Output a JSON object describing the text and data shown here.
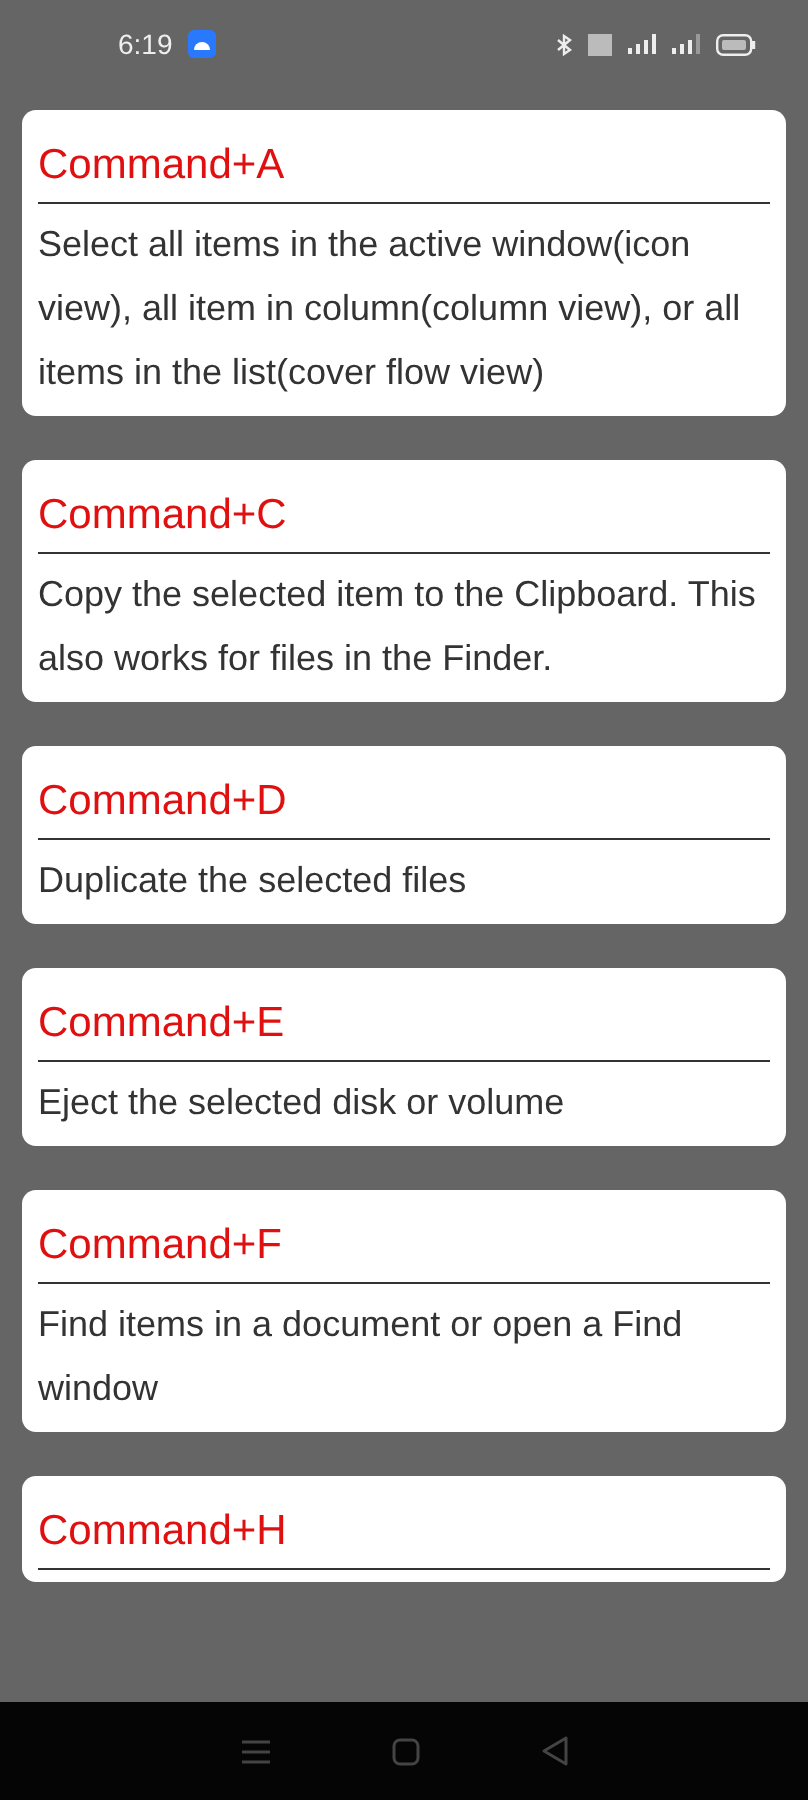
{
  "status_bar": {
    "time": "6:19"
  },
  "shortcuts": [
    {
      "keys": "Command+A",
      "description": "Select all items in the active window(icon view), all item in column(column view), or all items in the list(cover flow view)"
    },
    {
      "keys": "Command+C",
      "description": "Copy the selected item to the Clipboard. This also works for files in the Finder."
    },
    {
      "keys": "Command+D",
      "description": "Duplicate the selected files"
    },
    {
      "keys": "Command+E",
      "description": "Eject the selected disk or volume"
    },
    {
      "keys": "Command+F",
      "description": "Find items in a document or open a Find window"
    },
    {
      "keys": "Command+H"
    }
  ]
}
